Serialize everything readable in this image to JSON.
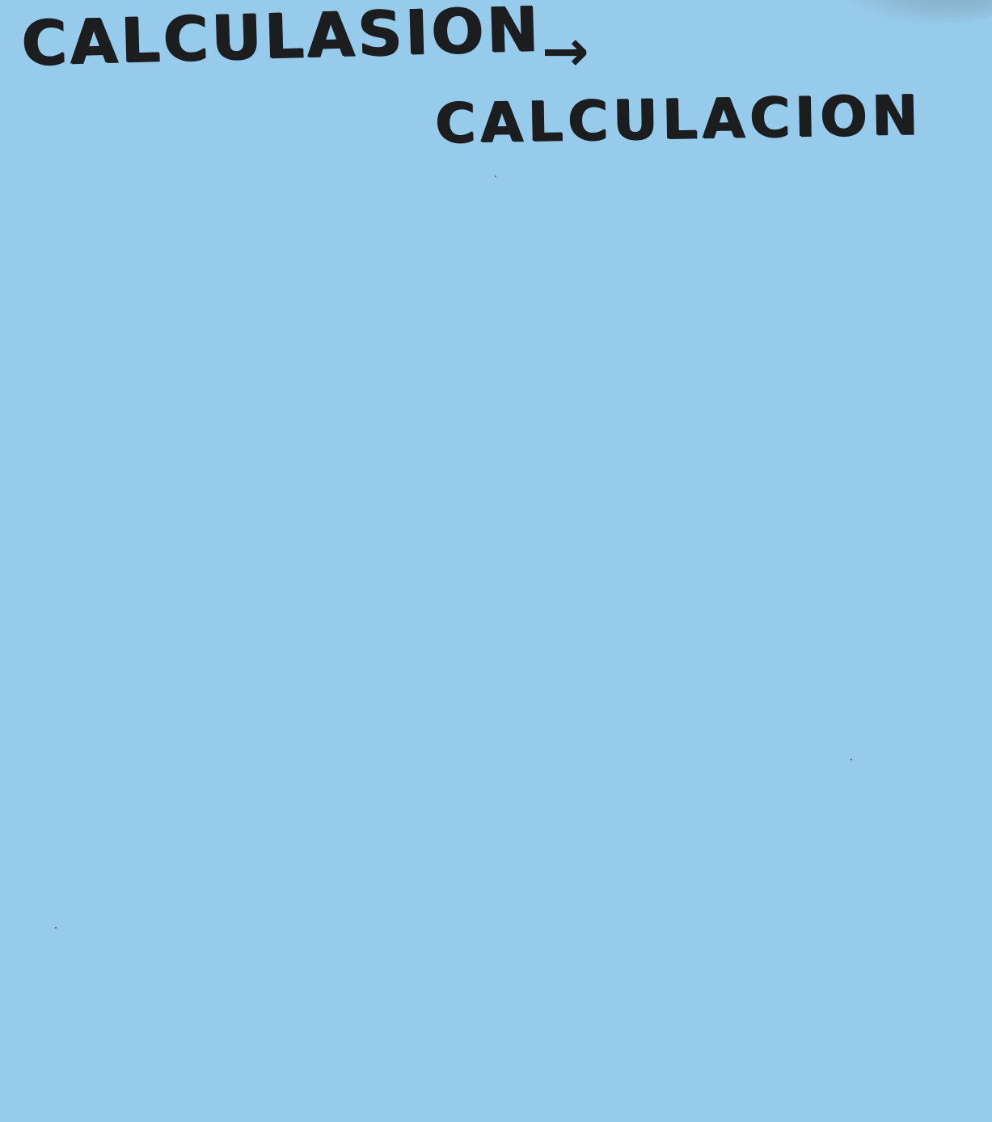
{
  "note": {
    "original_word": "CALCULASION",
    "arrow": "→",
    "corrected_word": "CALCULACION"
  },
  "colors": {
    "paper": "#97cbeb",
    "ink": "#1b1d1f"
  }
}
